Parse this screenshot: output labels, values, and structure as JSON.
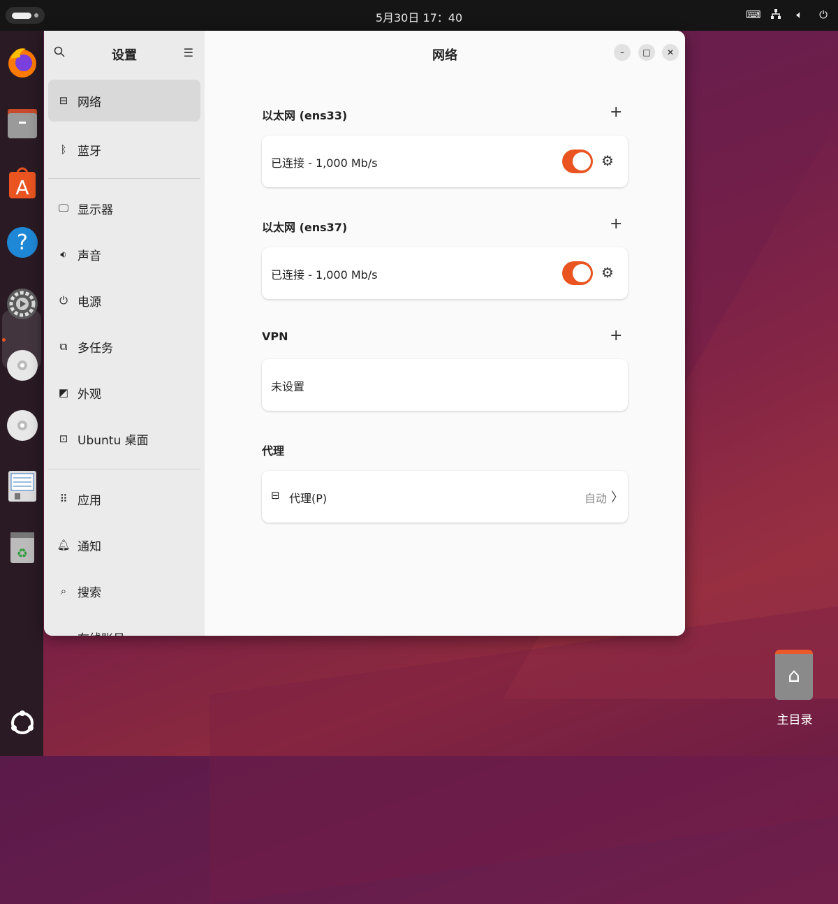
{
  "topbar": {
    "clock": "5月30日 17：40",
    "tray_icons": [
      "keyboard-icon",
      "network-icon",
      "volume-icon",
      "power-icon"
    ]
  },
  "dock": {
    "apps": [
      "firefox",
      "files",
      "app-center",
      "help",
      "settings",
      "cd-drive",
      "cd-drive",
      "text-editor",
      "trash",
      "show-apps"
    ],
    "active_app": "settings"
  },
  "window": {
    "sidebar": {
      "title": "设置",
      "items": [
        {
          "label": "网络",
          "icon": "network-icon"
        },
        {
          "label": "蓝牙",
          "icon": "bluetooth-icon"
        },
        {
          "label": "显示器",
          "icon": "monitor-icon"
        },
        {
          "label": "声音",
          "icon": "sound-icon"
        },
        {
          "label": "电源",
          "icon": "power-icon"
        },
        {
          "label": "多任务",
          "icon": "multitasking-icon"
        },
        {
          "label": "外观",
          "icon": "appearance-icon"
        },
        {
          "label": "Ubuntu 桌面",
          "icon": "ubuntu-desktop-icon"
        },
        {
          "label": "应用",
          "icon": "apps-grid-icon"
        },
        {
          "label": "通知",
          "icon": "bell-icon"
        },
        {
          "label": "搜索",
          "icon": "search-icon"
        },
        {
          "label": "在线账号",
          "icon": "online-accounts-icon"
        }
      ],
      "selected": "网络"
    },
    "content": {
      "title": "网络",
      "sections": {
        "ens33": {
          "title": "以太网 (ens33)",
          "status": "已连接 - 1,000 Mb/s",
          "enabled": true
        },
        "ens37": {
          "title": "以太网 (ens37)",
          "status": "已连接 - 1,000 Mb/s",
          "enabled": true
        },
        "vpn": {
          "title": "VPN",
          "status": "未设置"
        },
        "proxy": {
          "title": "代理",
          "label": "代理(P)",
          "value": "自动"
        }
      }
    }
  },
  "desktop": {
    "home_label": "主目录"
  },
  "colors": {
    "accent": "#e95420",
    "topbar": "#151515",
    "sidebar": "#ebebeb"
  }
}
